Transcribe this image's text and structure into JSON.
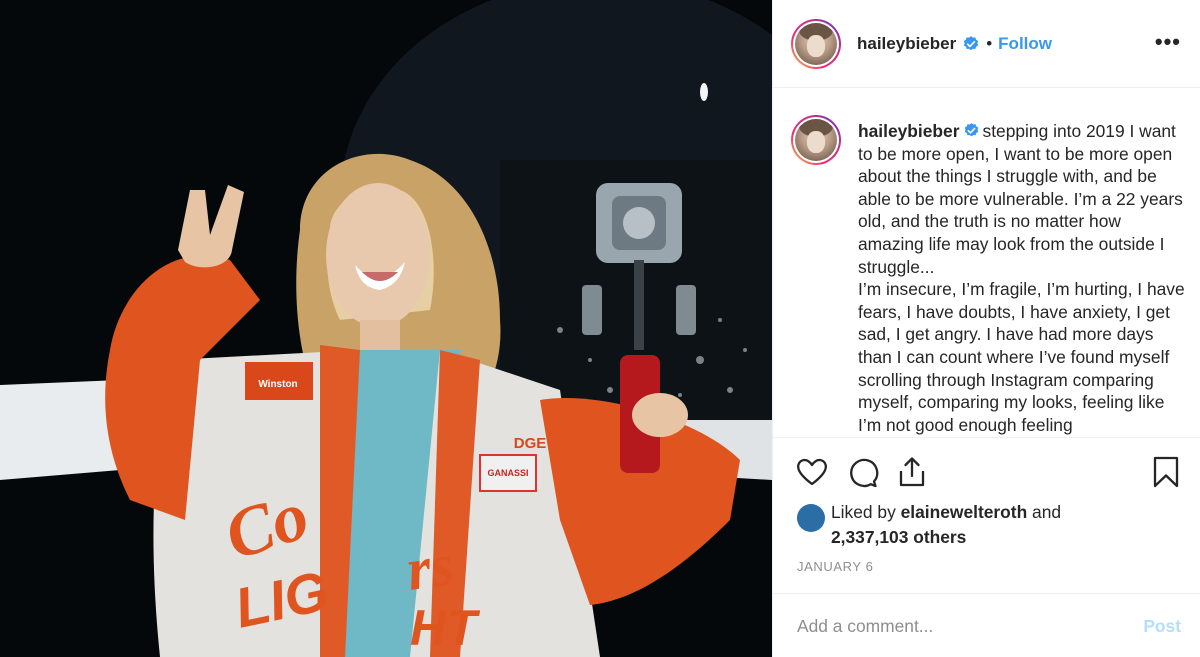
{
  "post": {
    "author": {
      "username": "haileybieber",
      "verified_icon": "verified-badge-icon",
      "follow_label": "Follow",
      "separator": "•",
      "more_label": "•••"
    },
    "photo": {
      "alt": "Photo of a smiling woman in an orange and white racing jacket holding a red phone and making a peace sign"
    },
    "caption": {
      "username": "haileybieber",
      "text": "stepping into 2019 I want to be more open, I want to be more open about the things I struggle with, and be able to be more vulnerable. I’m a 22 years old, and the truth is no matter how amazing life may look from the outside I struggle...",
      "text2": "I’m insecure, I’m fragile, I’m hurting, I have fears, I have doubts, I have anxiety, I get sad, I get angry. I have had more days than I can count where I’ve found myself scrolling through Instagram comparing myself, comparing my looks, feeling like I’m not good enough feeling"
    },
    "actions": {
      "like_icon": "heart-icon",
      "comment_icon": "comment-icon",
      "share_icon": "share-icon",
      "save_icon": "bookmark-icon"
    },
    "likes": {
      "prefix": "Liked by ",
      "liked_by": "elainewelteroth",
      "middle": " and",
      "others": "2,337,103 others"
    },
    "date": "JANUARY 6",
    "comment": {
      "placeholder": "Add a comment...",
      "post_label": "Post"
    },
    "colors": {
      "accent_blue": "#3897f0",
      "post_disabled": "#b2dffc",
      "muted_text": "#8e8e8e",
      "liker_avatar": "#2b6ea6"
    }
  }
}
